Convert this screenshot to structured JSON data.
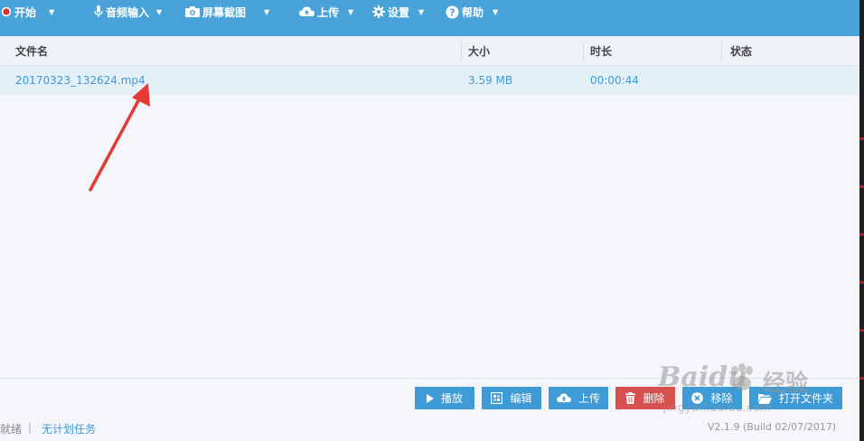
{
  "toolbar": {
    "start": "开始",
    "audio": "音频输入",
    "screenshot": "屏幕截图",
    "upload": "上传",
    "settings": "设置",
    "help": "帮助"
  },
  "table": {
    "columns": [
      "文件名",
      "大小",
      "时长",
      "状态"
    ],
    "rows": [
      {
        "name": "20170323_132624.mp4",
        "size": "3.59 MB",
        "duration": "00:00:44",
        "status": ""
      }
    ]
  },
  "actions": {
    "play": "播放",
    "edit": "编辑",
    "upload": "上传",
    "delete": "删除",
    "remove": "移除",
    "open_folder": "打开文件夹"
  },
  "statusbar": {
    "ready": "就绪",
    "separator": "|",
    "schedule": "无计划任务",
    "version": "V2.1.9 (Build 02/07/2017)"
  },
  "watermark": {
    "brand": "Baidu",
    "cn": "经验",
    "url": "jingyan.baidu.com"
  },
  "colors": {
    "toolbar": "#4aa3d8",
    "accent": "#3d9ad8",
    "button_blue": "#3e9bd6",
    "button_red": "#d84f4f",
    "record_red": "#d62f2f",
    "arrow": "#e53935"
  },
  "icons": [
    "record-icon",
    "microphone-icon",
    "camera-icon",
    "cloud-upload-icon",
    "gear-icon",
    "help-icon",
    "play-icon",
    "edit-icon",
    "trash-icon",
    "close-icon",
    "folder-icon"
  ]
}
